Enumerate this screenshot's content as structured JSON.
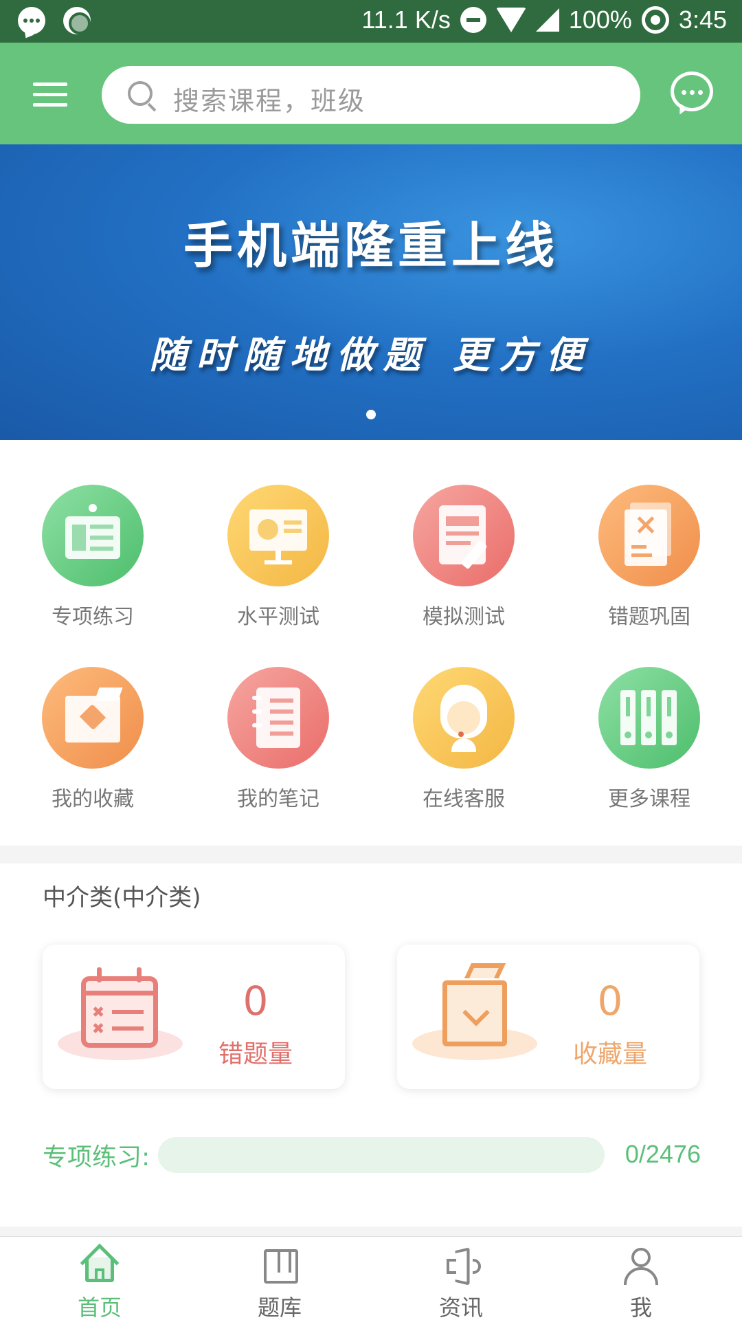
{
  "status_bar": {
    "speed": "11.1 K/s",
    "battery": "100%",
    "time": "3:45"
  },
  "header": {
    "search_placeholder": "搜索课程，班级"
  },
  "banner": {
    "title": "手机端隆重上线",
    "subtitle": "随时随地做题 更方便"
  },
  "grid": {
    "items": [
      {
        "label": "专项练习",
        "icon": "bulletin-board-icon",
        "color": "#5cc97b"
      },
      {
        "label": "水平测试",
        "icon": "presentation-icon",
        "color": "#f6c451"
      },
      {
        "label": "模拟测试",
        "icon": "document-pen-icon",
        "color": "#ee7f7a"
      },
      {
        "label": "错题巩固",
        "icon": "wrong-document-icon",
        "color": "#f39c5a"
      },
      {
        "label": "我的收藏",
        "icon": "favorite-folder-icon",
        "color": "#f39c5a"
      },
      {
        "label": "我的笔记",
        "icon": "notebook-icon",
        "color": "#ee7f7a"
      },
      {
        "label": "在线客服",
        "icon": "customer-service-icon",
        "color": "#f6c451"
      },
      {
        "label": "更多课程",
        "icon": "binders-icon",
        "color": "#5cc97b"
      }
    ]
  },
  "course": {
    "title": "中介类(中介类)",
    "wrong_count": "0",
    "wrong_label": "错题量",
    "favorite_count": "0",
    "favorite_label": "收藏量",
    "progress_label": "专项练习:",
    "progress_done": 0,
    "progress_total": 2476,
    "progress_text": "0/2476"
  },
  "bottom_nav": [
    {
      "label": "首页",
      "icon": "home-icon",
      "active": true
    },
    {
      "label": "题库",
      "icon": "question-bank-icon",
      "active": false
    },
    {
      "label": "资讯",
      "icon": "speaker-icon",
      "active": false
    },
    {
      "label": "我",
      "icon": "user-icon",
      "active": false
    }
  ],
  "colors": {
    "header": "#66c47c",
    "status_bar": "#2f6b3e",
    "accent": "#5cbf79",
    "wrong_red": "#e0706c",
    "favorite_orange": "#eea66b"
  }
}
